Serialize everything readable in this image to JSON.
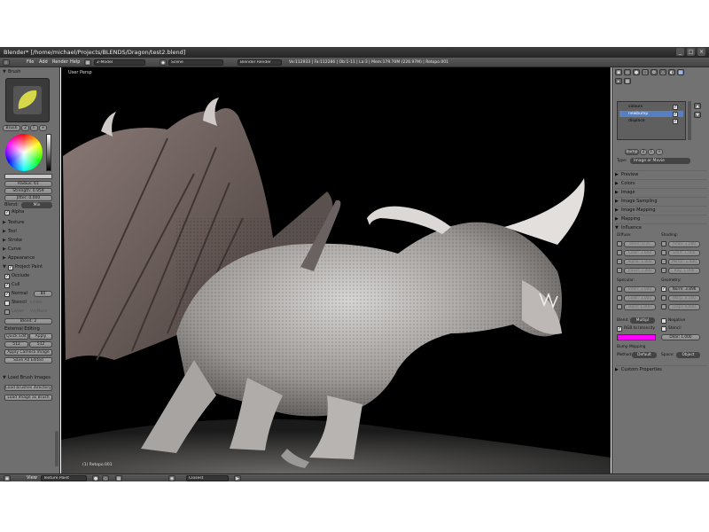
{
  "window": {
    "title": "Blender* [/home/michael/Projects/BLENDS/Dragon/test2.blend]",
    "buttons": [
      "_",
      "□",
      "×"
    ]
  },
  "info_header": {
    "menus": [
      "File",
      "Add",
      "Render",
      "Help"
    ],
    "screen": "2-Model",
    "scene": "Scene",
    "engine": "Blender Render",
    "stats": "Ve:112933 | Fa:112286 | Ob:1-11 | La:3 | Mem:179.70M (226.97M) | Retopo.001"
  },
  "left_panel": {
    "brush_header": "Brush",
    "brush_name": "Brush",
    "brush_count": "2",
    "brush_btn_f": "F",
    "radius": "Radius: 61",
    "strength": "Strength: 0.959",
    "jitter": "Jitter: 0.000",
    "blend_label": "Blend:",
    "blend_value": "Mix",
    "alpha_label": "Alpha",
    "sections": [
      "Texture",
      "Tool",
      "Stroke",
      "Curve",
      "Appearance"
    ],
    "project_paint": "Project Paint",
    "occlude": "Occlude",
    "cull": "Cull",
    "normal_label": "Normal",
    "normal_value": "80",
    "stencil": "Stencil",
    "stencil_extra": "Inflate",
    "layer": "Layer",
    "layer_extra": "Vis/Mode",
    "bleed": "Bleed: 2",
    "external_editing": "External Editing",
    "quick_edit": "Quick Edit",
    "apply": "Apply",
    "size_x": "512",
    "size_y": "512",
    "apply_camera_image": "Apply Camera Image",
    "save_all_edited": "Save All Edited",
    "load_brush_images": "Load Brush Images",
    "load_brushes_directory": "Load brushes directory",
    "load_image_as_brush": "Load Image as Brush"
  },
  "viewport": {
    "label": "User Persp",
    "object_label": "(1) Retopo.001"
  },
  "right_panel": {
    "textures": [
      "colours",
      "newbump",
      "displace"
    ],
    "texture_name": "bump",
    "texture_users": "2",
    "type_label": "Type:",
    "type_value": "Image or Movie",
    "sections_closed": [
      "Preview",
      "Colors",
      "Image",
      "Image Sampling",
      "Image Mapping",
      "Mapping"
    ],
    "influence": "Influence",
    "diffuse_header": "Diffuse:",
    "shading_header": "Shading:",
    "diffuse_fields": [
      "Inten: 0.35",
      "Color: 1.000",
      "Alpha: 1.000",
      "Transl: 1.000"
    ],
    "shading_fields": [
      "Ambi: 1.000",
      "Emit: 1.000",
      "Mirror: 1.000",
      "Ray: 1.000"
    ],
    "specular_header": "Specular:",
    "geometry_header": "Geometry:",
    "specular_fields": [
      "Inten: 1.000",
      "Color: 1.000",
      "Hard: 1.000"
    ],
    "geometry_fields": [
      "Norm: 3.896",
      "Warp: 0.000",
      "Displ: 0.000"
    ],
    "blend_label": "Blend:",
    "blend_value": "Multipl",
    "negative": "Negative",
    "rgb_to_intensity": "RGB to Intensity",
    "stencil": "Stencil",
    "dvar": "DVar: 1.000",
    "bump_mapping": "Bump Mapping",
    "method_label": "Method:",
    "method_value": "Default",
    "space_label": "Space:",
    "space_value": "Object",
    "custom_properties": "Custom Properties",
    "color_swatch": "#ff00ff"
  },
  "bottom_bar": {
    "view": "View",
    "mode": "Texture Paint",
    "pivot": "Closest"
  }
}
